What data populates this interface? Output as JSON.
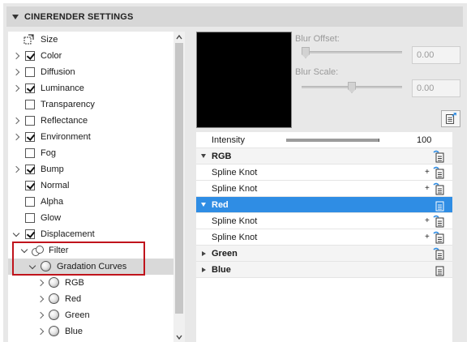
{
  "header": {
    "title": "CINERENDER SETTINGS"
  },
  "tree": {
    "items": [
      {
        "label": "Size",
        "checkbox": null,
        "expandable": false,
        "icon": "size-icon"
      },
      {
        "label": "Color",
        "checkbox": true,
        "expandable": true
      },
      {
        "label": "Diffusion",
        "checkbox": false,
        "expandable": true
      },
      {
        "label": "Luminance",
        "checkbox": true,
        "expandable": true
      },
      {
        "label": "Transparency",
        "checkbox": false,
        "expandable": false
      },
      {
        "label": "Reflectance",
        "checkbox": false,
        "expandable": true
      },
      {
        "label": "Environment",
        "checkbox": true,
        "expandable": true
      },
      {
        "label": "Fog",
        "checkbox": false,
        "expandable": false
      },
      {
        "label": "Bump",
        "checkbox": true,
        "expandable": true
      },
      {
        "label": "Normal",
        "checkbox": true,
        "expandable": false
      },
      {
        "label": "Alpha",
        "checkbox": false,
        "expandable": false
      },
      {
        "label": "Glow",
        "checkbox": false,
        "expandable": false
      },
      {
        "label": "Displacement",
        "checkbox": true,
        "expandable": true,
        "expanded": true
      },
      {
        "label": "Filter",
        "icon": "filter-icon",
        "expanded": true
      },
      {
        "label": "Gradation Curves",
        "icon": "sphere-icon",
        "expanded": true,
        "selected": true
      },
      {
        "label": "RGB",
        "icon": "sphere-icon"
      },
      {
        "label": "Red",
        "icon": "sphere-icon"
      },
      {
        "label": "Green",
        "icon": "sphere-icon"
      },
      {
        "label": "Blue",
        "icon": "sphere-icon"
      }
    ]
  },
  "params": {
    "blur_offset_label": "Blur Offset:",
    "blur_offset_value": "0.00",
    "blur_offset_level": 0.0,
    "blur_scale_label": "Blur Scale:",
    "blur_scale_value": "0.00",
    "blur_scale_level": 0.5
  },
  "list": {
    "intensity_label": "Intensity",
    "intensity_value": "100",
    "rows": [
      {
        "type": "group",
        "label": "RGB",
        "expanded": true
      },
      {
        "type": "item",
        "label": "Spline Knot"
      },
      {
        "type": "item",
        "label": "Spline Knot"
      },
      {
        "type": "group",
        "label": "Red",
        "expanded": true,
        "active": true
      },
      {
        "type": "item",
        "label": "Spline Knot"
      },
      {
        "type": "item",
        "label": "Spline Knot"
      },
      {
        "type": "group",
        "label": "Green",
        "expanded": false
      },
      {
        "type": "group",
        "label": "Blue",
        "expanded": false
      }
    ],
    "plus_symbol": "+"
  },
  "colors": {
    "accent": "#2f8de4",
    "highlight_box": "#c0141c",
    "preview_bg": "#000000"
  }
}
